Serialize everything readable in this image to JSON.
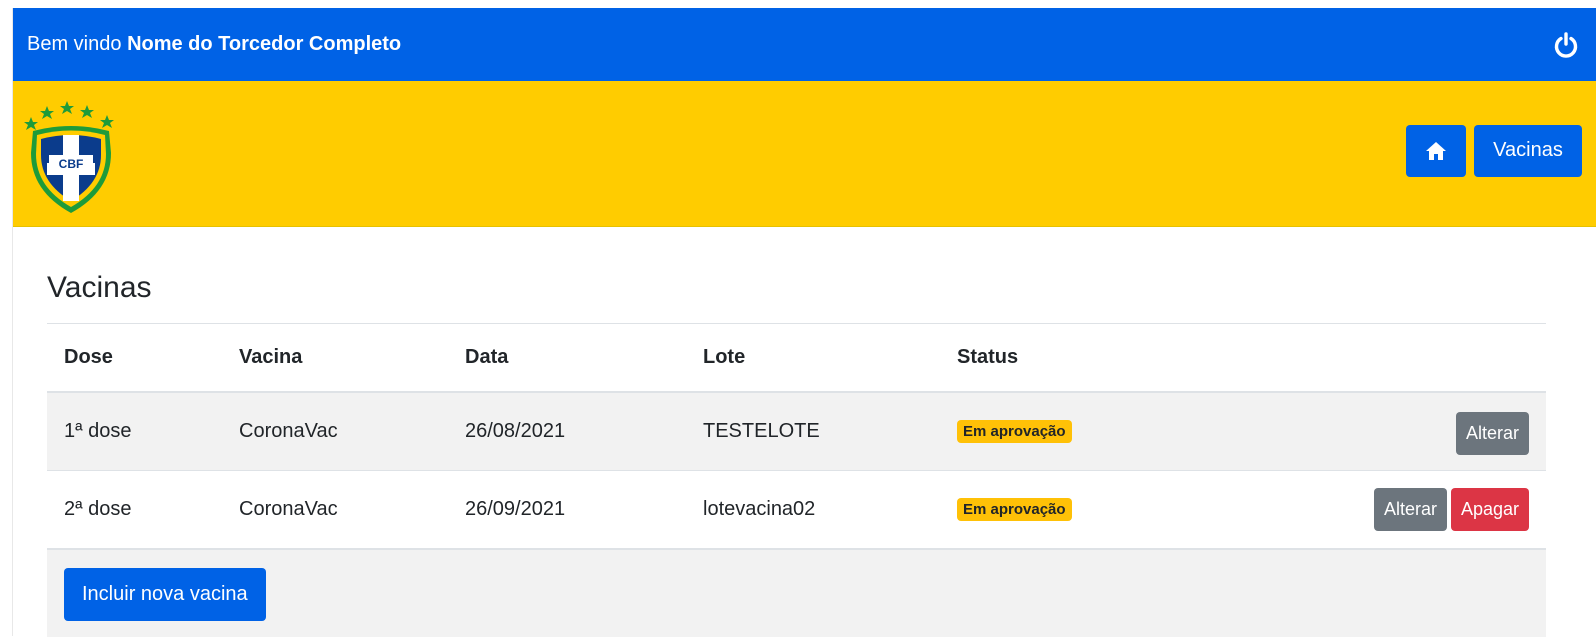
{
  "header": {
    "welcome_prefix": "Bem vindo",
    "user_name": "Nome do Torcedor Completo",
    "power_icon": "power-icon"
  },
  "brand": {
    "logo_text": "CBF"
  },
  "nav": {
    "home_icon": "home-icon",
    "vacinas_label": "Vacinas"
  },
  "page": {
    "title": "Vacinas"
  },
  "table": {
    "columns": [
      "Dose",
      "Vacina",
      "Data",
      "Lote",
      "Status"
    ],
    "rows": [
      {
        "dose": "1ª dose",
        "vacina": "CoronaVac",
        "data": "26/08/2021",
        "lote": "TESTELOTE",
        "status": "Em aprovação",
        "alterar": "Alterar"
      },
      {
        "dose": "2ª dose",
        "vacina": "CoronaVac",
        "data": "26/09/2021",
        "lote": "lotevacina02",
        "status": "Em aprovação",
        "alterar": "Alterar",
        "apagar": "Apagar"
      }
    ]
  },
  "footer": {
    "add_label": "Incluir nova vacina"
  },
  "colors": {
    "primary": "#0062e6",
    "brand_yellow": "#ffcc00",
    "warning": "#ffc107",
    "secondary": "#6c757d",
    "danger": "#dc3545"
  }
}
